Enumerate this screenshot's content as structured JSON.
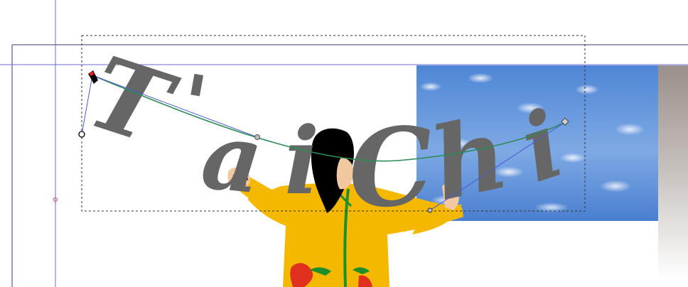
{
  "canvas": {
    "art_text": "T'ai Chi",
    "text_color": "#666666",
    "guide_color": "#6b6bd6",
    "page_border_color": "#3a3a6a",
    "path_color": "#2e8b57",
    "handle_line_color": "#4a5ad0",
    "figure": {
      "jacket_color": "#f5b800",
      "hair_color": "#000000",
      "skin_color": "#f2c8a0",
      "dragon_color": "#e0301e",
      "stripe_color": "#1f8f2a"
    },
    "sky_colors": [
      "#4f86d6",
      "#7ea9e4"
    ]
  }
}
